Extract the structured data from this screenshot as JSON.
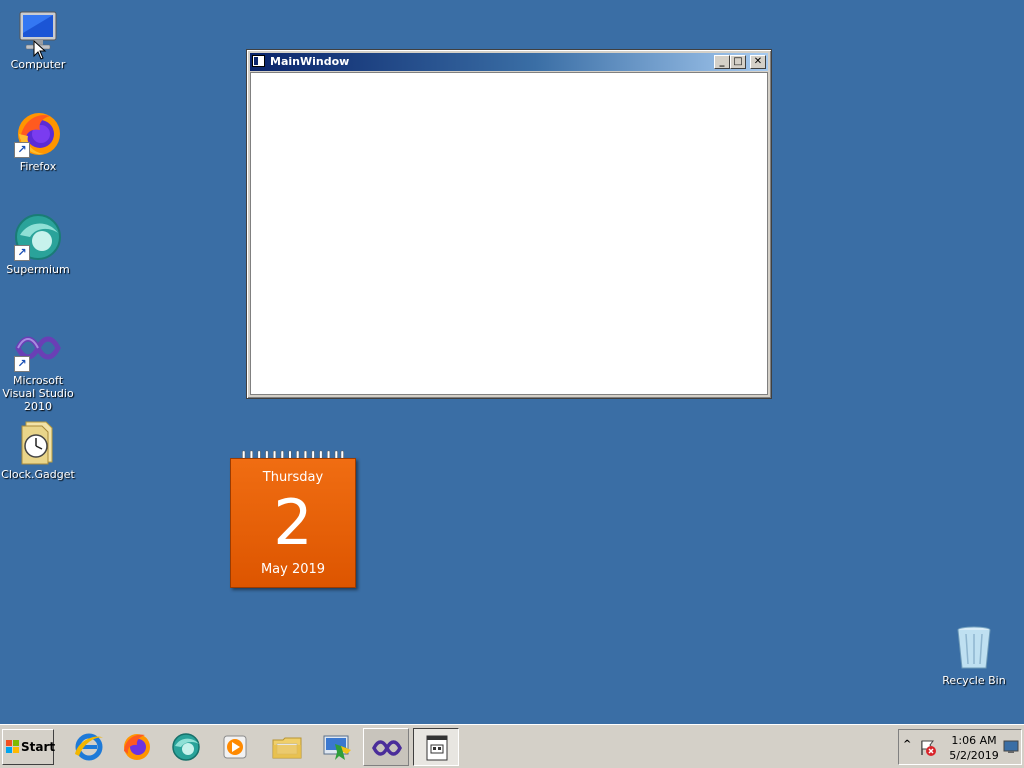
{
  "desktop": {
    "background": "#3a6ea5",
    "icons": [
      {
        "label": "Computer",
        "icon": "computer-icon"
      },
      {
        "label": "Firefox",
        "icon": "firefox-icon"
      },
      {
        "label": "Supermium",
        "icon": "supermium-icon"
      },
      {
        "label": "Microsoft Visual Studio 2010",
        "icon": "visual-studio-icon"
      },
      {
        "label": "Clock.Gadget",
        "icon": "clock-gadget-icon"
      },
      {
        "label": "Recycle Bin",
        "icon": "recycle-bin-icon"
      }
    ]
  },
  "main_window": {
    "title": "MainWindow",
    "minimize_label": "_",
    "maximize_label": "□",
    "close_label": "✕"
  },
  "calendar": {
    "day_of_week": "Thursday",
    "day": "2",
    "month_year": "May 2019"
  },
  "taskbar": {
    "start_label": "Start",
    "items": [
      {
        "icon": "internet-explorer-icon",
        "state": "normal"
      },
      {
        "icon": "firefox-icon",
        "state": "normal"
      },
      {
        "icon": "supermium-icon",
        "state": "normal"
      },
      {
        "icon": "media-player-icon",
        "state": "normal"
      },
      {
        "icon": "file-explorer-icon",
        "state": "normal"
      },
      {
        "icon": "control-panel-icon",
        "state": "normal"
      },
      {
        "icon": "visual-studio-icon",
        "state": "hover"
      },
      {
        "icon": "application-window-icon",
        "state": "active"
      }
    ],
    "tray": {
      "expand_label": "^",
      "time": "1:06 AM",
      "date": "5/2/2019"
    }
  }
}
